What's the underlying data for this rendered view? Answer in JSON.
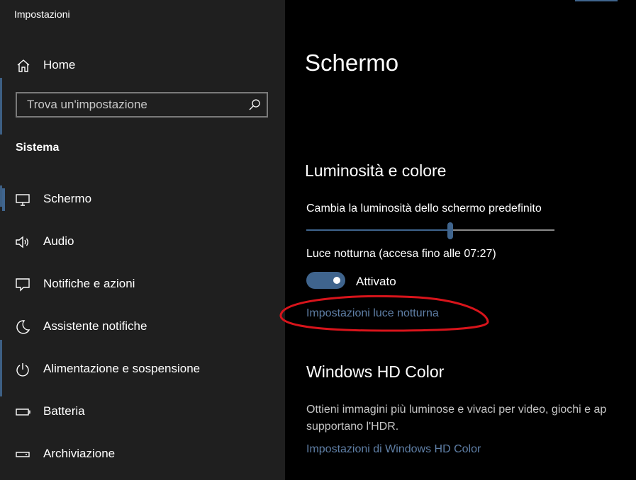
{
  "window": {
    "title": "Impostazioni"
  },
  "sidebar": {
    "home_label": "Home",
    "search": {
      "placeholder": "Trova un'impostazione",
      "value": ""
    },
    "section_title": "Sistema",
    "items": [
      {
        "label": "Schermo",
        "icon": "monitor-icon",
        "active": true
      },
      {
        "label": "Audio",
        "icon": "speaker-icon"
      },
      {
        "label": "Notifiche e azioni",
        "icon": "notification-icon"
      },
      {
        "label": "Assistente notifiche",
        "icon": "moon-icon"
      },
      {
        "label": "Alimentazione e sospensione",
        "icon": "power-icon"
      },
      {
        "label": "Batteria",
        "icon": "battery-icon"
      },
      {
        "label": "Archiviazione",
        "icon": "storage-icon"
      }
    ]
  },
  "main": {
    "title": "Schermo",
    "brightness": {
      "heading": "Luminosità e colore",
      "slider_label": "Cambia la luminosità dello schermo predefinito",
      "slider_value": 0.58,
      "night_light_label": "Luce notturna (accesa fino alle 07:27)",
      "toggle_state": "Attivato",
      "toggle_on": true,
      "night_light_settings_link": "Impostazioni luce notturna"
    },
    "hd_color": {
      "heading": "Windows HD Color",
      "description_line1": "Ottieni immagini più luminose e vivaci per video, giochi e ap",
      "description_line2": "supportano l'HDR.",
      "settings_link": "Impostazioni di Windows HD Color"
    }
  },
  "colors": {
    "accent": "#3f648d",
    "link": "#5f7fa6",
    "sidebar_bg": "#1f1f1f",
    "main_bg": "#000000",
    "annotation": "#d8141b"
  }
}
